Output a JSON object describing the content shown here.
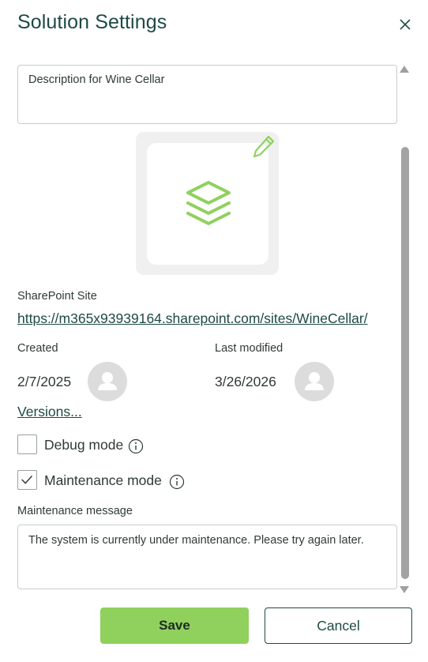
{
  "dialog": {
    "title": "Solution Settings",
    "close_icon": "close-icon"
  },
  "form": {
    "description": "Description for Wine Cellar",
    "solution_icon": "layers-stack-icon",
    "edit_icon": "pencil-icon",
    "sharepoint_label": "SharePoint Site",
    "sharepoint_url": "https://m365x93939164.sharepoint.com/sites/WineCellar/",
    "created_label": "Created",
    "created_date": "2/7/2025",
    "modified_label": "Last modified",
    "modified_date": "3/26/2026",
    "versions_link": "Versions...",
    "debug_label": "Debug mode",
    "debug_checked": false,
    "maintenance_label": "Maintenance mode",
    "maintenance_checked": true,
    "maintenance_message_label": "Maintenance message",
    "maintenance_message": "The system is currently under maintenance. Please try again later."
  },
  "actions": {
    "save_label": "Save",
    "cancel_label": "Cancel"
  },
  "colors": {
    "accent_green": "#8fd15c",
    "heading_teal": "#1e4a44"
  }
}
